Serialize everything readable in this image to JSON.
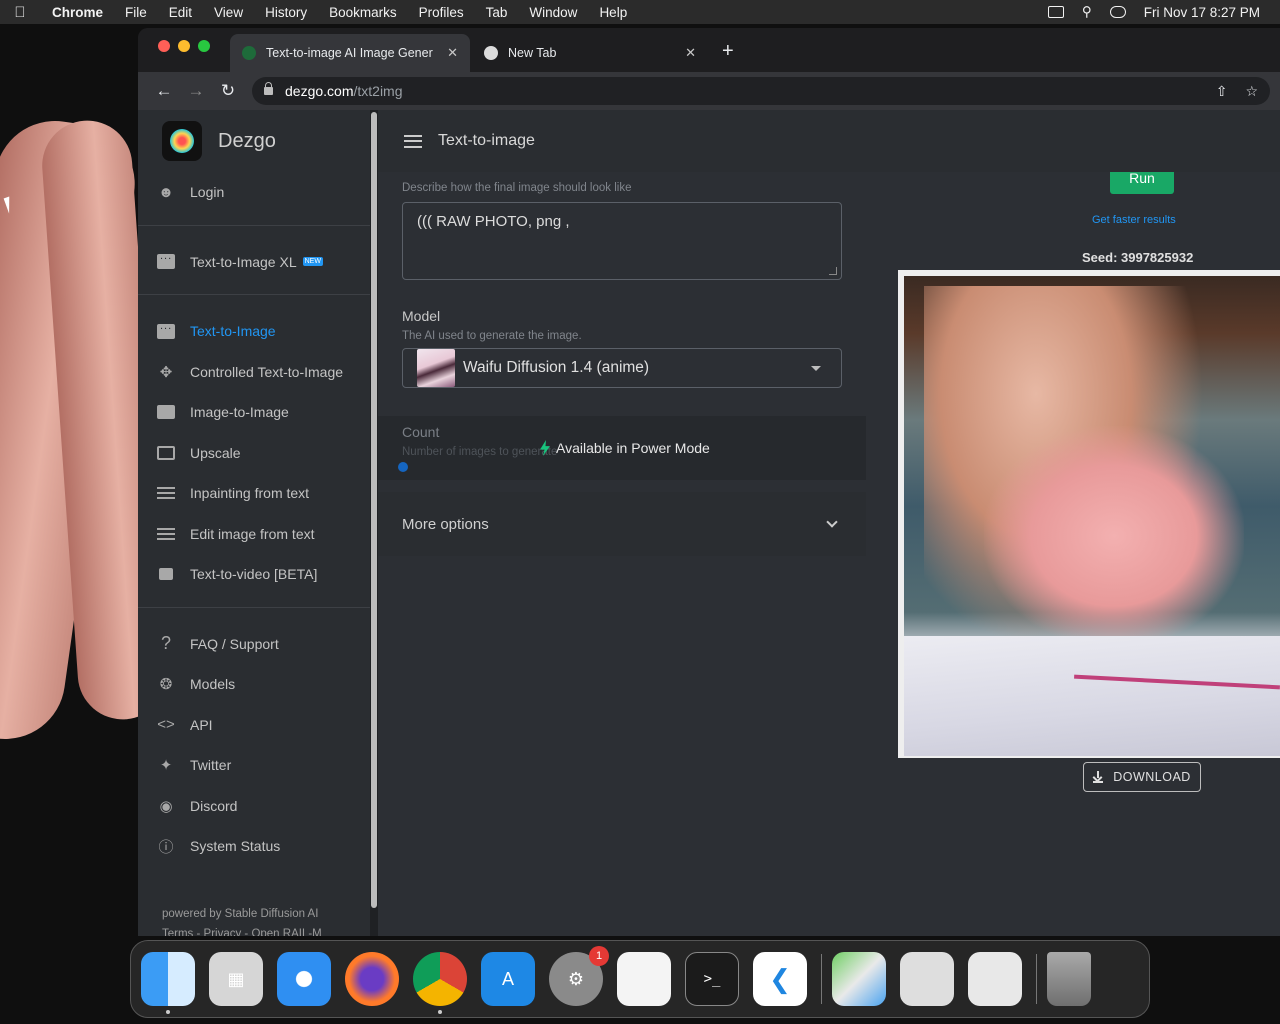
{
  "menubar": {
    "app": "Chrome",
    "items": [
      "File",
      "Edit",
      "View",
      "History",
      "Bookmarks",
      "Profiles",
      "Tab",
      "Window",
      "Help"
    ],
    "clock": "Fri Nov 17  8:27 PM"
  },
  "browser": {
    "tabs": [
      {
        "title": "Text-to-image AI Image Gener",
        "active": true
      },
      {
        "title": "New Tab",
        "active": false
      }
    ],
    "url_host": "dezgo.com",
    "url_path": "/txt2img"
  },
  "sidebar": {
    "brand": "Dezgo",
    "login": "Login",
    "xl_item": "Text-to-Image XL",
    "xl_badge": "NEW",
    "tools": [
      "Text-to-Image",
      "Controlled Text-to-Image",
      "Image-to-Image",
      "Upscale",
      "Inpainting from text",
      "Edit image from text",
      "Text-to-video [BETA]"
    ],
    "links": [
      "FAQ / Support",
      "Models",
      "API",
      "Twitter",
      "Discord",
      "System Status"
    ],
    "footer_line1": "powered by Stable Diffusion AI",
    "footer_line2": "Terms - Privacy - Open RAIL-M"
  },
  "appbar": {
    "title": "Text-to-image"
  },
  "form": {
    "prompt_hint": "Describe how the final image should look like",
    "prompt_value": "((( RAW PHOTO, png ,",
    "model_label": "Model",
    "model_hint": "The AI used to generate the image.",
    "model_value": "Waifu Diffusion 1.4 (anime)",
    "count_label": "Count",
    "count_hint": "Number of images to generate",
    "power_mode": "Available in Power Mode",
    "more_options": "More options"
  },
  "result": {
    "run_label": "Run",
    "faster_link": "Get faster results",
    "seed": "Seed: 3997825932",
    "download_label": "DOWNLOAD"
  },
  "dock": {
    "apps": [
      "finder-icon",
      "launchpad-icon",
      "safari-icon",
      "firefox-icon",
      "chrome-icon",
      "app-store-icon",
      "system-settings-icon",
      "textedit-icon",
      "terminal-icon",
      "vscode-icon",
      "maps-icon",
      "disk-utility-icon",
      "disk-diag-icon",
      "trash-icon"
    ],
    "settings_badge": "1"
  },
  "colors": {
    "accent": "#2196f3",
    "run_green": "#19a866",
    "bolt": "#19c37d"
  }
}
